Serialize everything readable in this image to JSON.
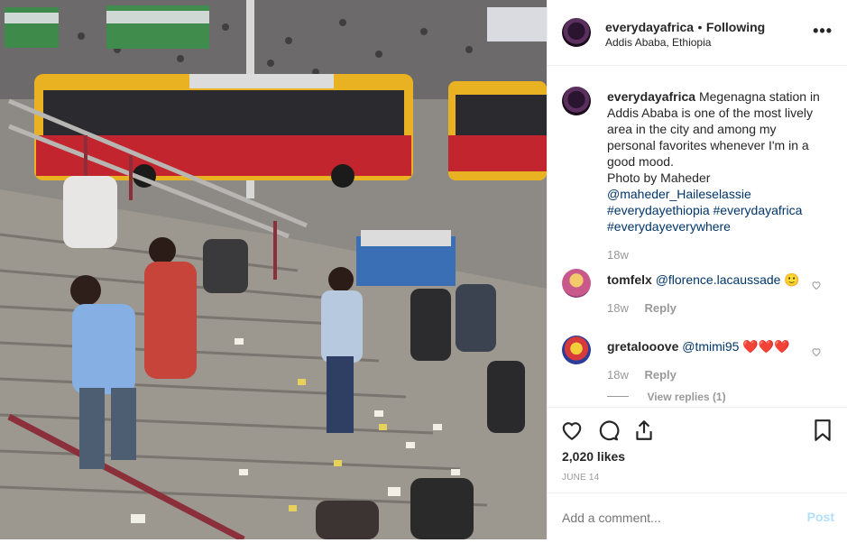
{
  "post": {
    "username": "everydayafrica",
    "follow_separator": "•",
    "follow_state": "Following",
    "location": "Addis Ababa, Ethiopia",
    "more_label": "•••"
  },
  "caption": {
    "username": "everydayafrica",
    "lines": [
      "Megenagna station in",
      "Addis Ababa is one of the most lively",
      "area in the city and among my",
      "personal favorites whenever I'm in a",
      "good mood.",
      "Photo by Maheder"
    ],
    "mention": "@maheder_Haileselassie",
    "hashtags_line1": "#everydayethiopia #everydayafrica",
    "hashtags_line2": "#everydayeverywhere",
    "age": "18w"
  },
  "comments": [
    {
      "username": "tomfelx",
      "mention": "@florence.lacaussade",
      "emoji": "🙂",
      "age": "18w",
      "reply_label": "Reply"
    },
    {
      "username": "gretalooove",
      "mention": "@tmimi95",
      "emoji": "❤️❤️❤️",
      "age": "18w",
      "reply_label": "Reply",
      "view_replies": "View replies (1)"
    }
  ],
  "engagement": {
    "likes": "2,020 likes",
    "date": "JUNE 14"
  },
  "comment_box": {
    "placeholder": "Add a comment...",
    "post_label": "Post"
  },
  "icons": {
    "more": "more-icon",
    "like": "heart-icon",
    "comment": "comment-icon",
    "share": "share-icon",
    "save": "bookmark-icon",
    "comment_like": "small-heart-icon"
  },
  "colors": {
    "link": "#003569",
    "muted": "#999999",
    "post_button": "#b2dffc",
    "text": "#262626"
  }
}
